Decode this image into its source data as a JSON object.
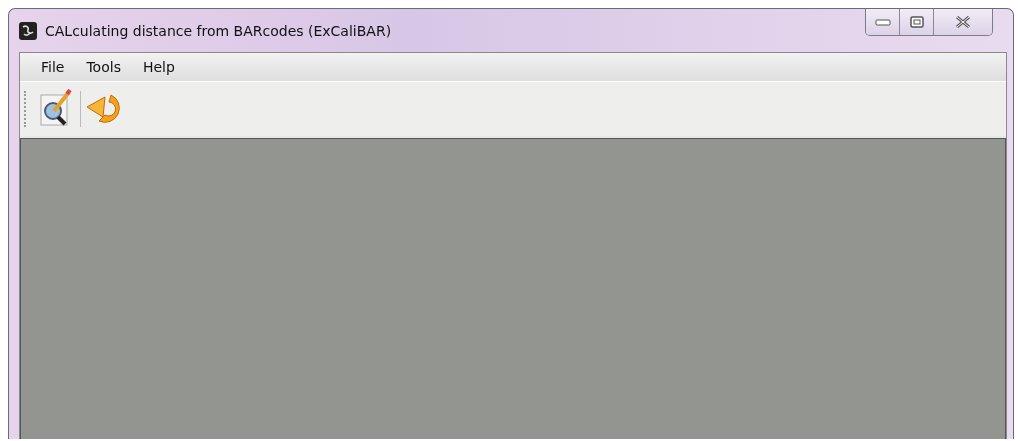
{
  "window": {
    "title": "CALculating distance from BARcodes (ExCaliBAR)"
  },
  "menu": [
    {
      "label": "File"
    },
    {
      "label": "Tools"
    },
    {
      "label": "Help"
    }
  ],
  "toolbar": [
    {
      "kind": "edit-search"
    },
    {
      "kind": "refresh"
    }
  ]
}
